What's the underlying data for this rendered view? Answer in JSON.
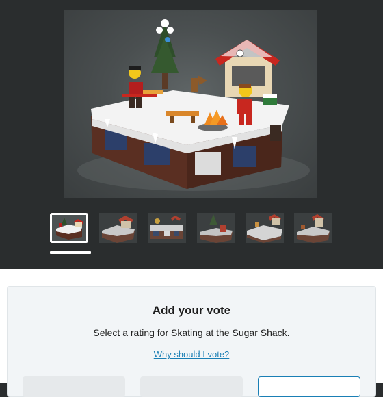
{
  "gallery": {
    "main_image_alt": "LEGO skating scene at the Sugar Shack",
    "thumbnails": [
      {
        "name": "thumbnail-1",
        "active": true
      },
      {
        "name": "thumbnail-2",
        "active": false
      },
      {
        "name": "thumbnail-3",
        "active": false
      },
      {
        "name": "thumbnail-4",
        "active": false
      },
      {
        "name": "thumbnail-5",
        "active": false
      },
      {
        "name": "thumbnail-6",
        "active": false
      }
    ]
  },
  "vote": {
    "title": "Add your vote",
    "subtitle": "Select a rating for Skating at the Sugar Shack.",
    "why_link": "Why should I vote?"
  },
  "colors": {
    "background": "#2a2d2e",
    "accent": "#1a7fb5"
  }
}
